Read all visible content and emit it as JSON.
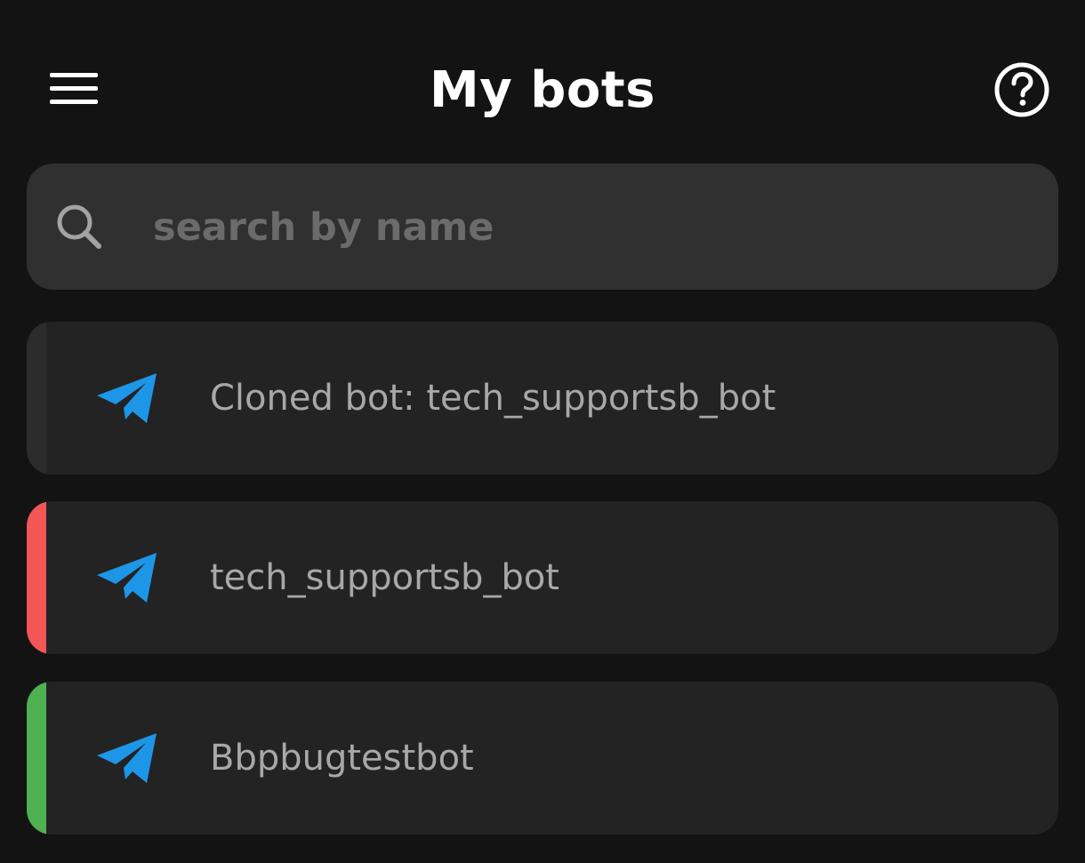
{
  "header": {
    "title": "My bots",
    "menu_icon": "hamburger-menu-icon",
    "help_icon": "help-circle-icon"
  },
  "search": {
    "placeholder": "search by name",
    "value": "",
    "icon": "search-icon"
  },
  "bots": [
    {
      "name": "Cloned bot: tech_supportsb_bot",
      "icon": "telegram-paper-plane-icon",
      "status_color": "#2c2c2c"
    },
    {
      "name": "tech_supportsb_bot",
      "icon": "telegram-paper-plane-icon",
      "status_color": "#f25656"
    },
    {
      "name": "Bbpbugtestbot",
      "icon": "telegram-paper-plane-icon",
      "status_color": "#4fb152"
    }
  ],
  "colors": {
    "background": "#131313",
    "search_box": "#303030",
    "card": "#232323",
    "telegram_blue": "#1e96e8",
    "text_primary": "#ffffff",
    "text_secondary": "#a8a8a8",
    "placeholder": "#6b6b6b"
  }
}
